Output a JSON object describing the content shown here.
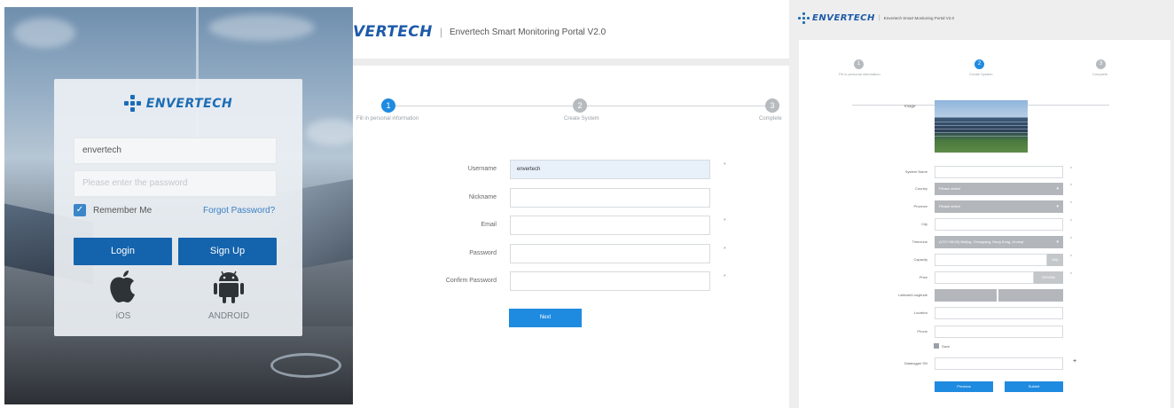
{
  "login": {
    "brand": "ENVERTECH",
    "username_value": "envertech",
    "password_placeholder": "Please enter the password",
    "remember_label": "Remember Me",
    "forgot_label": "Forgot Password?",
    "login_label": "Login",
    "signup_label": "Sign Up",
    "ios_label": "iOS",
    "android_label": "ANDROID",
    "ios_icon": "apple-icon",
    "android_icon": "android-icon"
  },
  "register": {
    "brand_partial": "VERTECH",
    "portal_title": "Envertech Smart Monitoring Portal V2.0",
    "steps": [
      {
        "num": "1",
        "label": "Fill in personal information"
      },
      {
        "num": "2",
        "label": "Create System"
      },
      {
        "num": "3",
        "label": "Complete"
      }
    ],
    "fields": [
      {
        "label": "Username",
        "value": "envertech",
        "required": "*"
      },
      {
        "label": "Nickname",
        "value": "",
        "required": ""
      },
      {
        "label": "Email",
        "value": "",
        "required": "*"
      },
      {
        "label": "Password",
        "value": "",
        "required": "*"
      },
      {
        "label": "Confirm Password",
        "value": "",
        "required": "*"
      }
    ],
    "next_label": "Next"
  },
  "system": {
    "brand": "ENVERTECH",
    "portal_title": "Envertech Smart Monitoring Portal V2.0",
    "steps": [
      {
        "num": "1",
        "label": "Fill in personal information"
      },
      {
        "num": "2",
        "label": "Create System"
      },
      {
        "num": "3",
        "label": "Complete"
      }
    ],
    "image_label": "Image",
    "fields": [
      {
        "label": "System Name",
        "value": "",
        "required": "*"
      },
      {
        "label": "Country",
        "value": "Please select",
        "required": "*"
      },
      {
        "label": "Province",
        "value": "Please select",
        "required": "*"
      },
      {
        "label": "City",
        "value": "",
        "required": "*"
      },
      {
        "label": "Timezone",
        "value": "(UTC+08:00) Beijing, Chongqing, Hong Kong, Urumqi",
        "required": "*"
      },
      {
        "label": "Capacity",
        "value": "",
        "unit": "kWp",
        "required": "*"
      },
      {
        "label": "Price",
        "value": "",
        "unit": "CNY/kWh",
        "required": "*"
      },
      {
        "label": "Latitude/Longitude",
        "value": "",
        "required": ""
      },
      {
        "label": "Location",
        "value": "",
        "required": ""
      },
      {
        "label": "Phone",
        "value": "",
        "required": ""
      }
    ],
    "save_label": "Save",
    "datalogger_label": "Datalogger SN",
    "datalogger_extra": "+",
    "previous_label": "Previous",
    "submit_label": "Submit"
  }
}
